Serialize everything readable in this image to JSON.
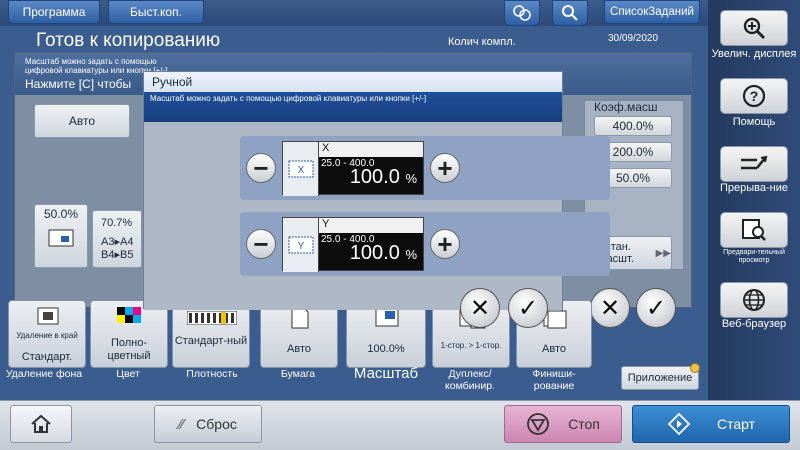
{
  "topbar": {
    "program_label": "Программа",
    "quickcopy_label": "Быст.коп.",
    "joblist_label": "СписокЗаданий",
    "icons": [
      "connect-icon",
      "search-icon"
    ]
  },
  "status": {
    "title": "Готов к копированию",
    "counter_label": "Колич компл.",
    "date": "30/09/2020"
  },
  "background_dialog": {
    "hint": "Масштаб можно задать с помощью цифровой клавиатуры или кнопки [+/-]",
    "prompt": "Нажмите [С] чтобы",
    "auto_label": "Авто",
    "preset_value": "50.0%",
    "ratio_value": "70.7%",
    "paper_row1": "A3▸A4",
    "paper_row2": "B4▸B5",
    "coef_title": "Коэф.масш",
    "coef_options": [
      "400.0%",
      "200.0%",
      "50.0%"
    ],
    "set_zoom_label": "Устан. масшт."
  },
  "manual_dialog": {
    "title": "Ручной",
    "message": "Масштаб можно задать с помощью цифровой клавиатуры или кнопки [+/-]",
    "x_axis": {
      "label": "X",
      "range": "25.0 - 400.0",
      "value": "100.0",
      "unit": "%"
    },
    "y_axis": {
      "label": "Y",
      "range": "25.0 - 400.0",
      "value": "100.0",
      "unit": "%"
    }
  },
  "tiles": [
    {
      "top": "Удаление в край",
      "value": "Стандарт.",
      "caption": "Удаление фона"
    },
    {
      "value": "Полно-цветный",
      "caption": "Цвет"
    },
    {
      "value": "Стандарт-ный",
      "caption": "Плотность"
    },
    {
      "value": "Авто",
      "caption": "Бумага"
    },
    {
      "value": "100.0%",
      "caption": "Масштаб"
    },
    {
      "value": "1-стор. > 1-стор.",
      "caption": "Дуплекс/ комбинир."
    },
    {
      "value": "Авто",
      "caption": "Финиши-рование"
    }
  ],
  "app_button": "Приложение",
  "sidebar": {
    "zoom_label": "Увелич. дисплея",
    "help_label": "Помощь",
    "interrupt_label": "Прерыва-ние",
    "preview_label": "Предвари-тельный просмотр",
    "browser_label": "Веб-браузер"
  },
  "bottom": {
    "reset_label": "Сброс",
    "stop_label": "Стоп",
    "start_label": "Старт"
  }
}
